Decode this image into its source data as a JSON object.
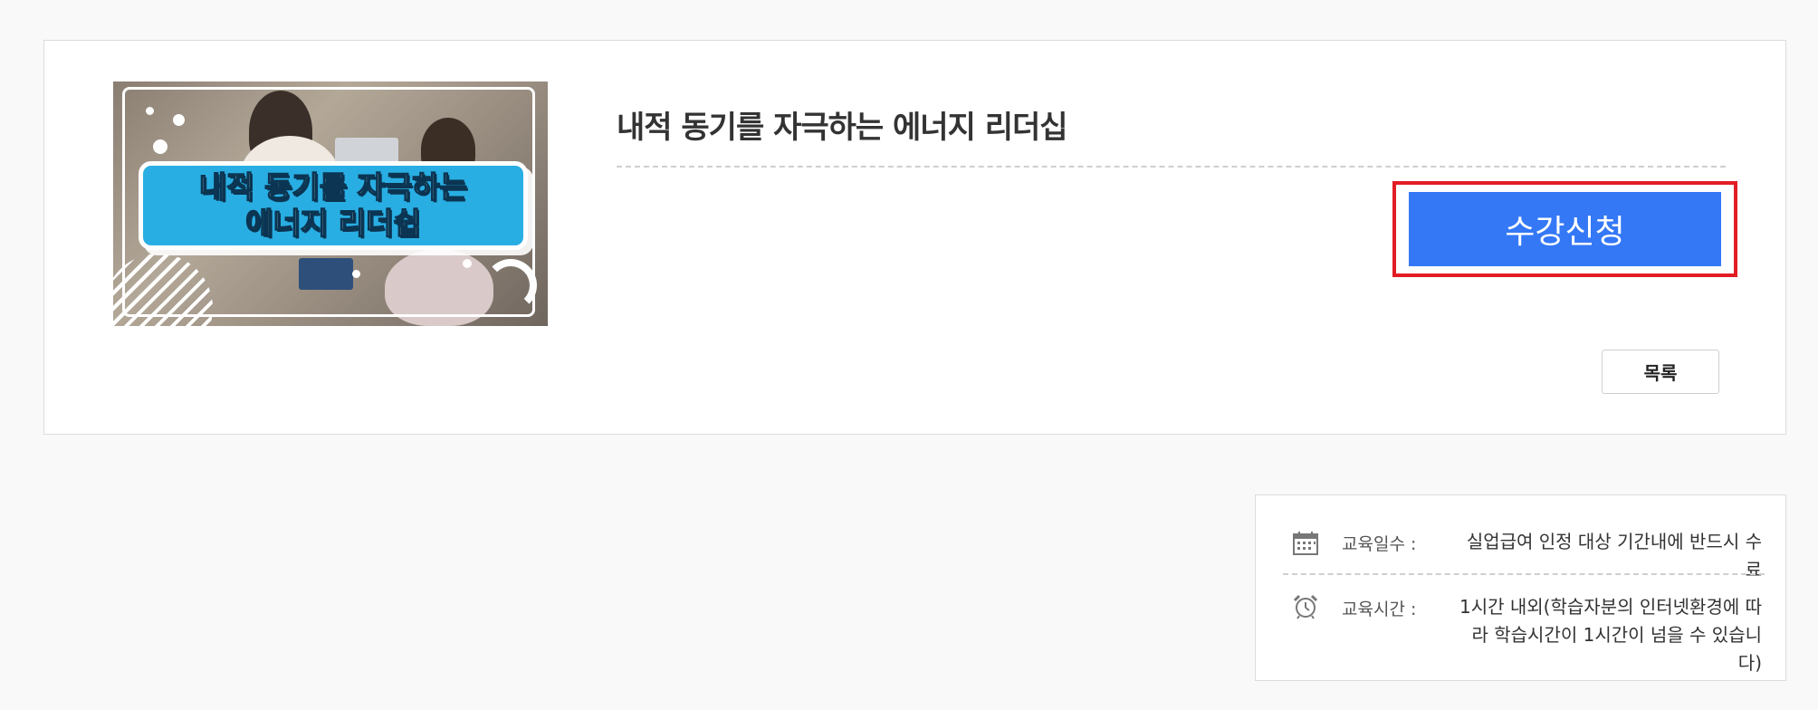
{
  "course": {
    "title": "내적 동기를 자극하는 에너지 리더십",
    "thumbnail": {
      "line1": "내적 동기를 자극하는",
      "line2": "에너지 리더쉽"
    }
  },
  "actions": {
    "apply_label": "수강신청",
    "list_label": "목록"
  },
  "info": {
    "days_label": "교육일수 :",
    "days_value": "실업급여 인정 대상 기간내에 반드시 수료",
    "hours_label": "교육시간 :",
    "hours_value_line1": "1시간 내외(학습자분의 인터넷환경에 따",
    "hours_value_line2": "라 학습시간이 1시간이 넘을 수 있습니다)"
  },
  "icons": {
    "days": "calendar-icon",
    "hours": "alarm-clock-icon"
  },
  "colors": {
    "apply_button": "#3478f6",
    "highlight_border": "#e31d25",
    "thumbnail_banner": "#29aee3"
  }
}
